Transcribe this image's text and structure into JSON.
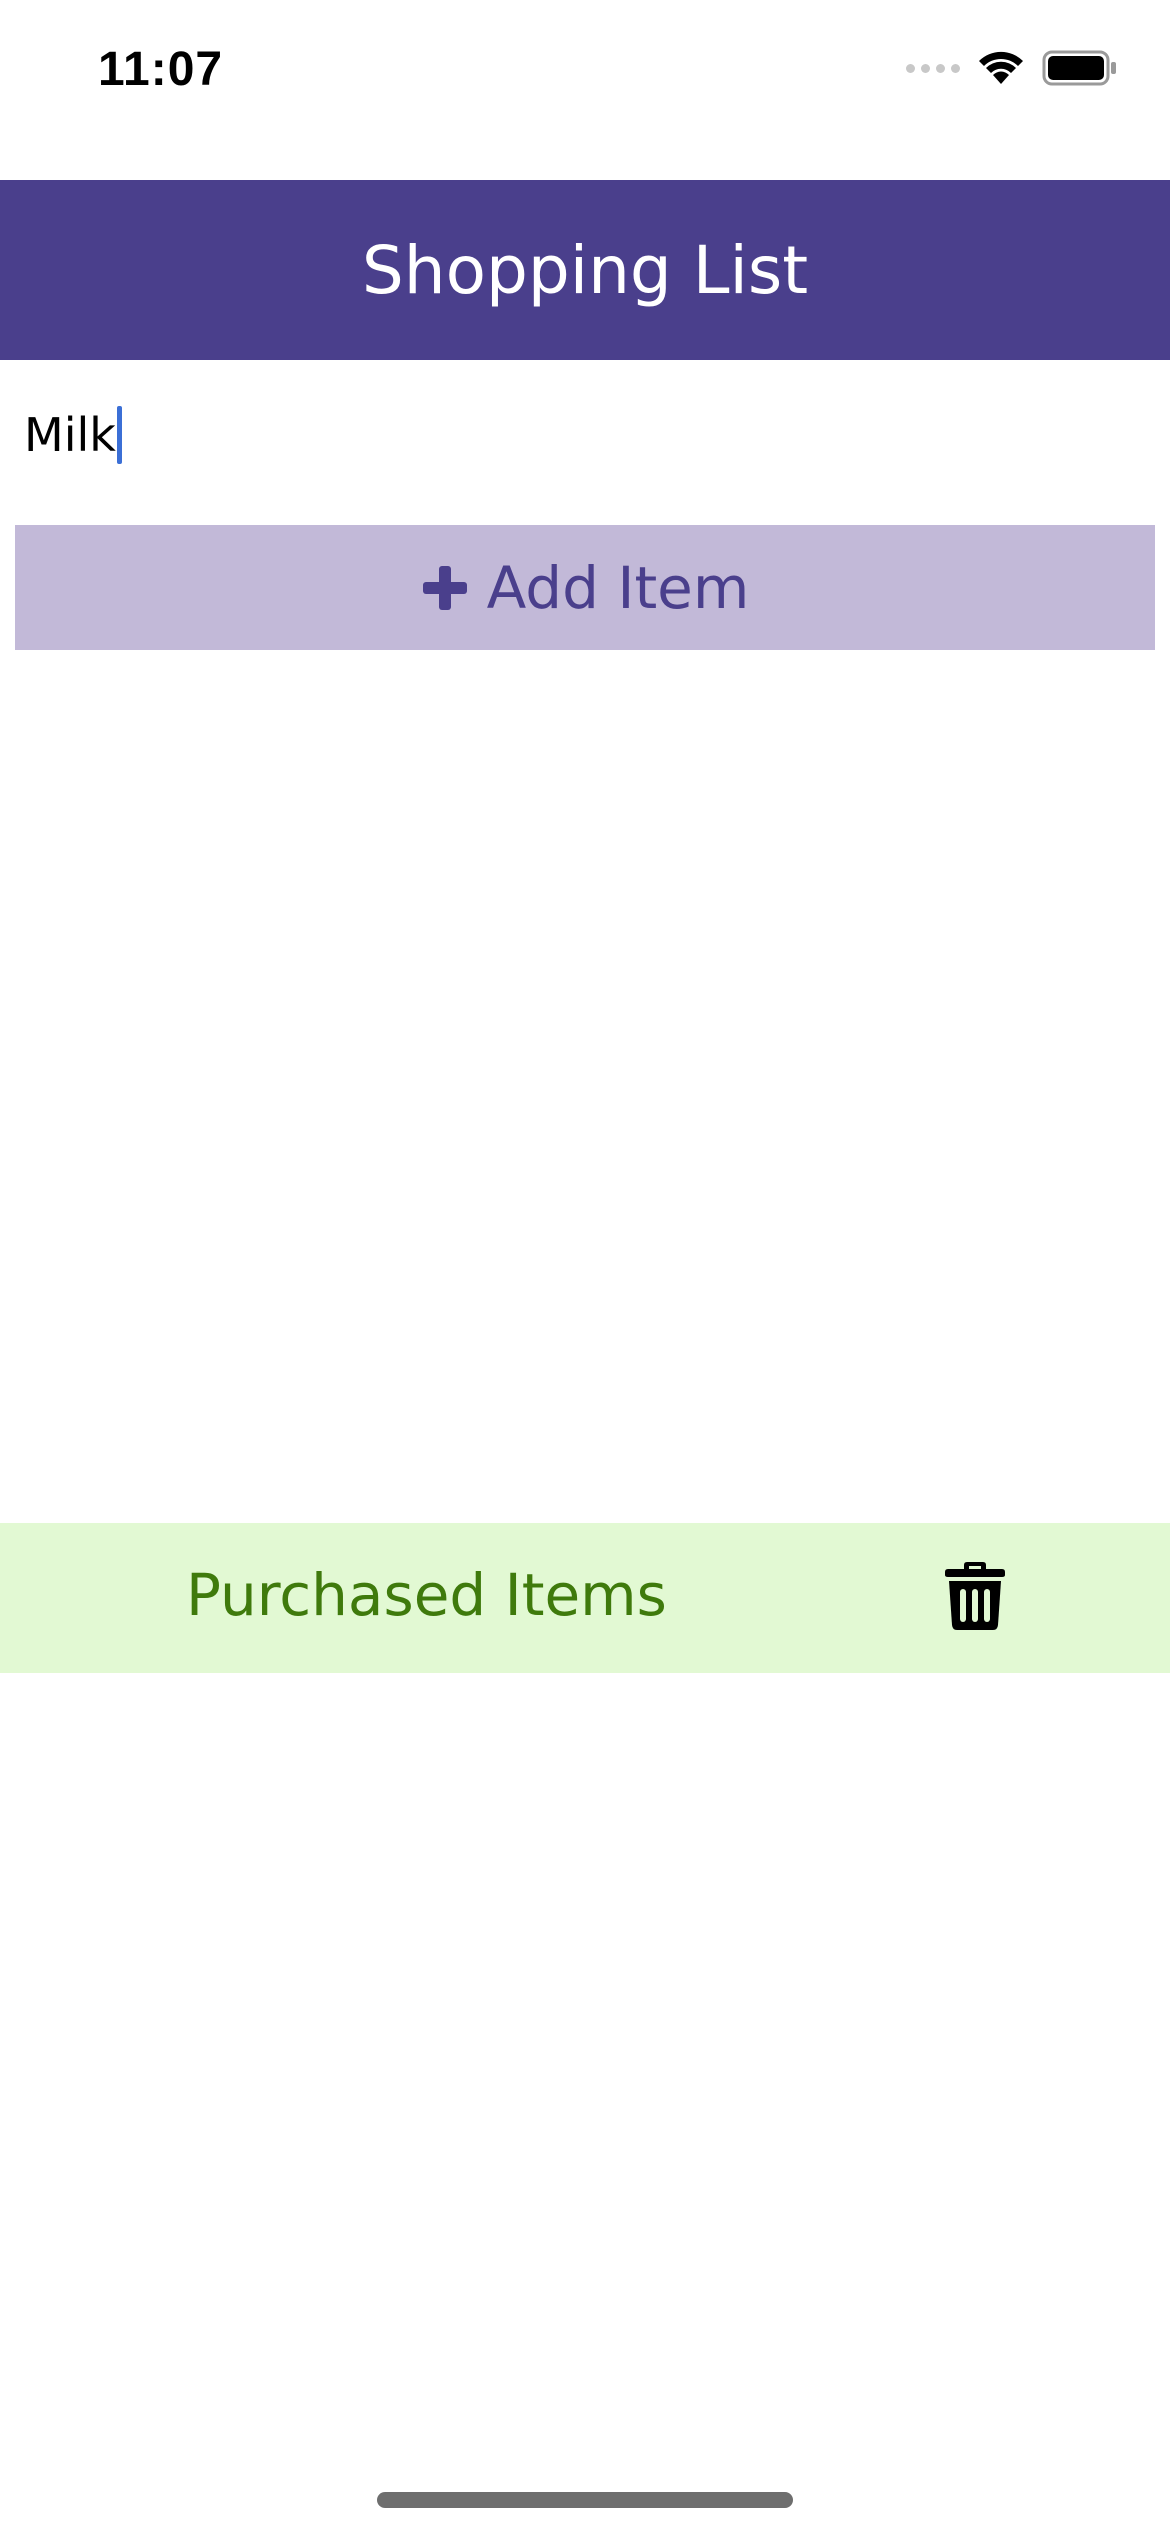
{
  "status_bar": {
    "time": "11:07",
    "icons": [
      "cellular-signal-icon",
      "wifi-icon",
      "battery-icon"
    ]
  },
  "header": {
    "title": "Shopping List",
    "background": "#4a3f8c",
    "text_color": "#ffffff"
  },
  "item_input": {
    "value": "Milk",
    "caret_color": "#3b6fd6"
  },
  "add_button": {
    "icon": "plus-icon",
    "label": "Add Item",
    "background": "#c2b9d8",
    "text_color": "#4a3f8c"
  },
  "shopping_items": [],
  "purchased_section": {
    "label": "Purchased Items",
    "delete_icon": "trash-icon",
    "background": "#e2f9d3",
    "text_color": "#3f7a0c"
  }
}
